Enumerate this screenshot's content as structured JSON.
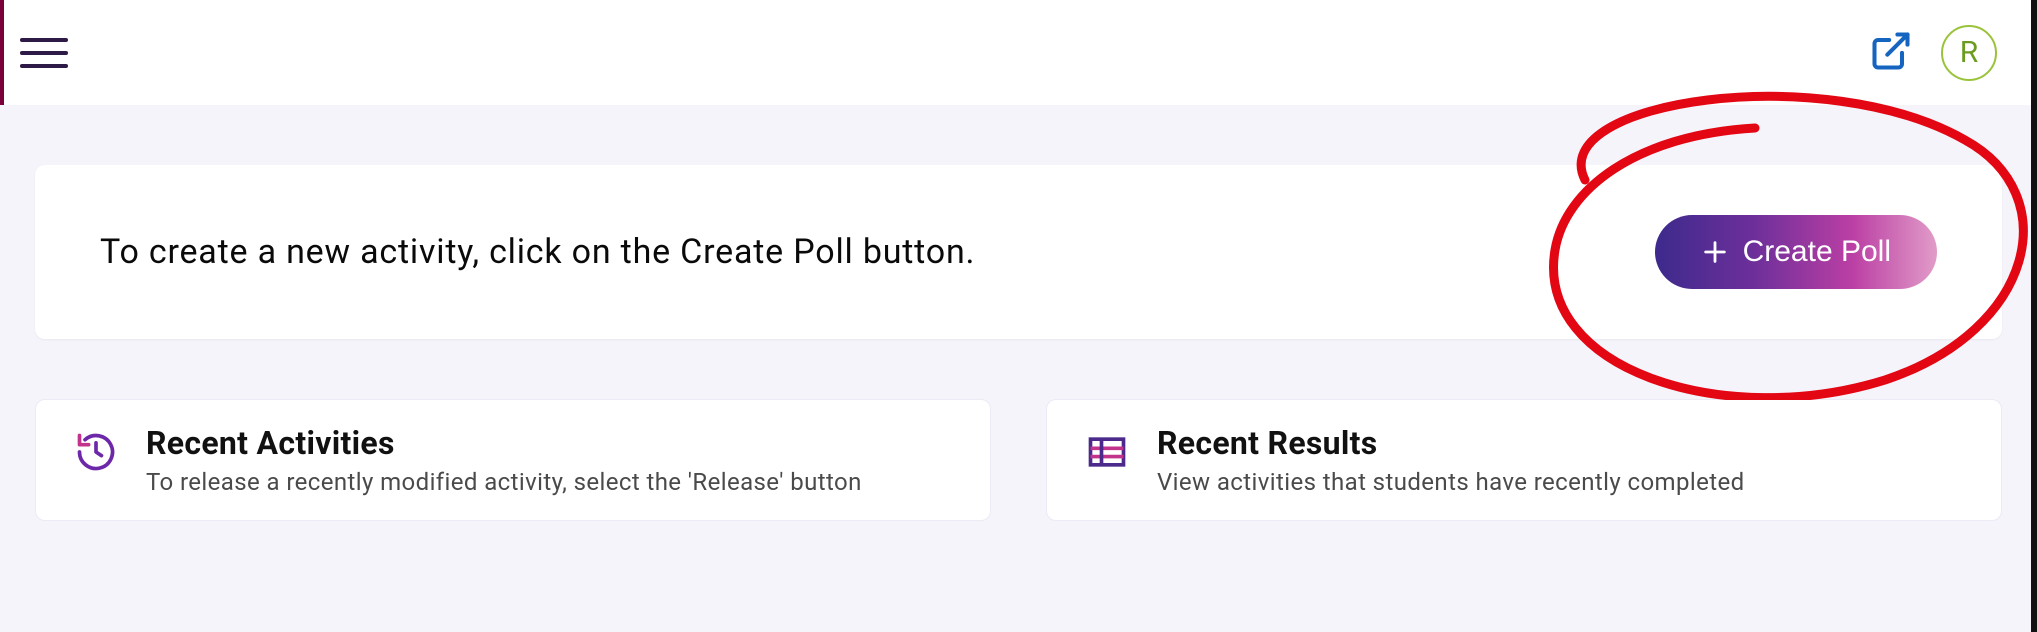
{
  "header": {
    "avatar_initial": "R"
  },
  "banner": {
    "prompt_text": "To create a new activity, click on the Create Poll button.",
    "create_button_label": "Create Poll"
  },
  "cards": {
    "recent_activities": {
      "title": "Recent Activities",
      "description": "To release a recently modified activity, select the 'Release' button"
    },
    "recent_results": {
      "title": "Recent Results",
      "description": "View activities that students have recently completed"
    }
  }
}
